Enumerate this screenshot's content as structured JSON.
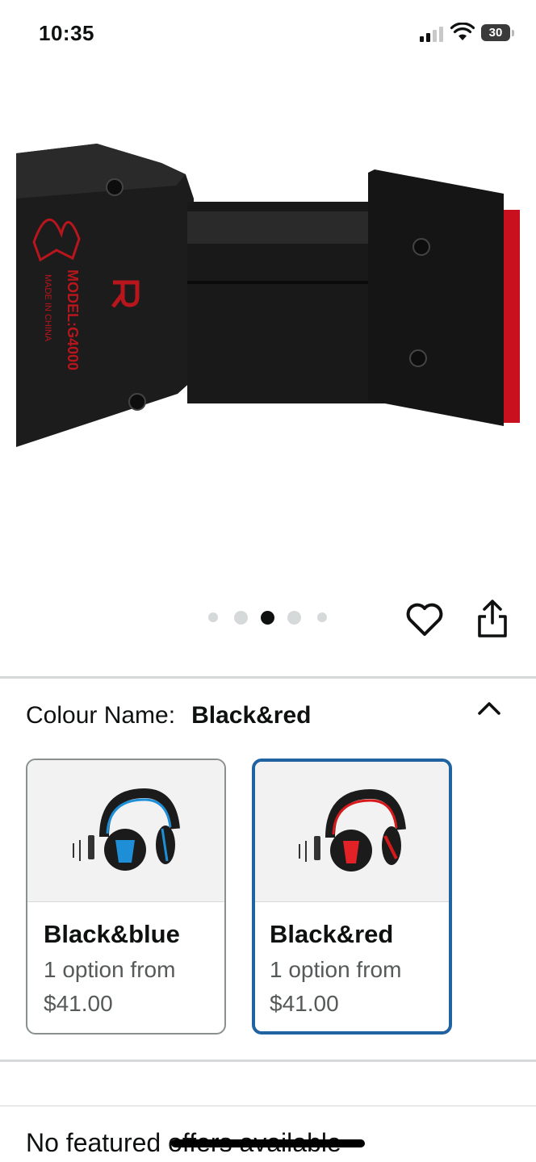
{
  "status_bar": {
    "time": "10:35",
    "battery": "30",
    "icons": [
      "signal-icon",
      "wifi-icon",
      "battery-icon"
    ]
  },
  "product_image": {
    "alt": "headset headband",
    "model_text": "MODEL:G4000",
    "made_in_text": "MADE IN CHINA",
    "side_mark": "R"
  },
  "carousel": {
    "total": 5,
    "active_index": 2
  },
  "actions": {
    "favorite_icon": "heart-icon",
    "share_icon": "share-icon"
  },
  "colour": {
    "label": "Colour Name:",
    "selected": "Black&red",
    "collapse_icon": "chevron-up-icon",
    "options": [
      {
        "name": "Black&blue",
        "subtitle": "1 option from",
        "price": "$41.00",
        "selected": false,
        "accent": "#1e8fd6"
      },
      {
        "name": "Black&red",
        "subtitle": "1 option from",
        "price": "$41.00",
        "selected": true,
        "accent": "#d7191c"
      }
    ]
  },
  "offers": {
    "text": "No featured offers available"
  },
  "colors": {
    "selected_border": "#2162a1",
    "divider": "#d5d9d9",
    "text_secondary": "#565959"
  }
}
